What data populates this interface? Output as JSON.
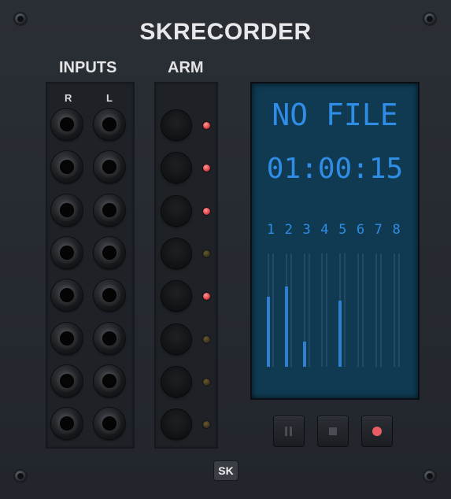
{
  "module": {
    "title": "SKRECORDER",
    "logo_text": "SK"
  },
  "inputs": {
    "label": "INPUTS",
    "col_right": "R",
    "col_left": "L",
    "jack_rows": 8
  },
  "arm": {
    "label": "ARM",
    "channels": [
      {
        "armed": true
      },
      {
        "armed": true
      },
      {
        "armed": true
      },
      {
        "armed": false
      },
      {
        "armed": true
      },
      {
        "armed": false
      },
      {
        "armed": false
      },
      {
        "armed": false
      }
    ]
  },
  "display": {
    "file_text": "NO FILE",
    "time_text": "01:00:15",
    "channel_numbers": [
      "1",
      "2",
      "3",
      "4",
      "5",
      "6",
      "7",
      "8"
    ],
    "meters": [
      {
        "left": 0.62,
        "right": 0.0
      },
      {
        "left": 0.71,
        "right": 0.0
      },
      {
        "left": 0.22,
        "right": 0.0
      },
      {
        "left": 0.0,
        "right": 0.0
      },
      {
        "left": 0.58,
        "right": 0.0
      },
      {
        "left": 0.0,
        "right": 0.0
      },
      {
        "left": 0.0,
        "right": 0.0
      },
      {
        "left": 0.0,
        "right": 0.0
      }
    ]
  },
  "transport": {
    "pause": "pause-button",
    "stop": "stop-button",
    "record": "record-button"
  },
  "colors": {
    "panel": "#262a30",
    "display_bg": "#0f3a52",
    "display_text": "#2f8de6",
    "led_on": "#e0454b",
    "record": "#e85d64"
  }
}
